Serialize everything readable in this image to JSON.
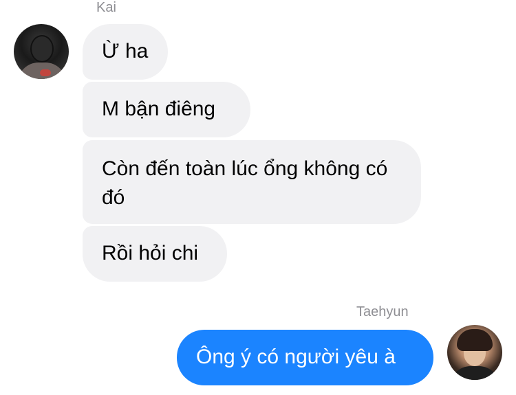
{
  "conversation": {
    "incoming": {
      "sender_name": "Kai",
      "messages": [
        "Ừ ha",
        "M bận điêng",
        "Còn đến toàn lúc ổng không có đó",
        "Rồi hỏi chi"
      ]
    },
    "outgoing": {
      "sender_name": "Taehyun",
      "messages": [
        "Ông ý có người yêu à"
      ]
    }
  },
  "colors": {
    "incoming_bubble": "#f1f1f3",
    "outgoing_bubble": "#1b84ff",
    "name_text": "#8e8e93"
  }
}
